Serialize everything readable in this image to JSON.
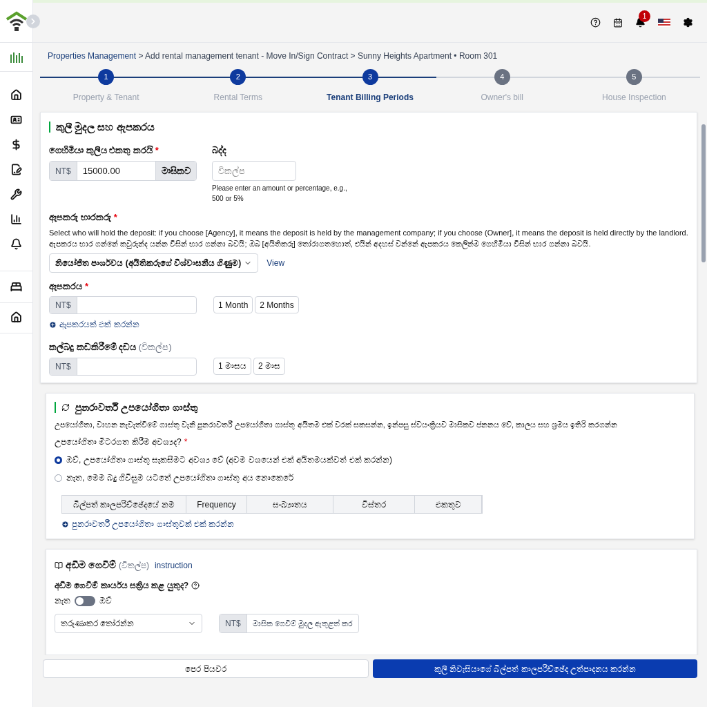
{
  "topbar": {
    "notification_count": "1"
  },
  "breadcrumb": {
    "link": "Properties Management",
    "path": " > Add rental management tenant - Move In/Sign Contract > Sunny Heights Apartment • Room 301"
  },
  "steps": [
    {
      "number": "1",
      "label": "Property & Tenant",
      "reached": true,
      "current": false
    },
    {
      "number": "2",
      "label": "Rental Terms",
      "reached": true,
      "current": false
    },
    {
      "number": "3",
      "label": "Tenant Billing Periods",
      "reached": true,
      "current": true
    },
    {
      "number": "4",
      "label": "Owner's bill",
      "reached": false,
      "current": false
    },
    {
      "number": "5",
      "label": "House Inspection",
      "reached": false,
      "current": false
    }
  ],
  "rent_section": {
    "title": "කුලී මුදල සහ ඇපකරය",
    "rent": {
      "label": "ගෙහිමියා කුලිය එකතු කරයි",
      "required_mark": "*",
      "prefix": "NT$",
      "value": "15000.00",
      "suffix": "මාසිකව"
    },
    "tax": {
      "label": "බද්ද",
      "placeholder": "විකල්ප",
      "help": "Please enter an amount or percentage, e.g., 500 or 5%"
    },
    "holder": {
      "label": "ඇපකරු භාරකරු",
      "required_mark": "*",
      "help_en": "Select who will hold the deposit: if you choose [Agency], it means the deposit is held by the management company;  if you choose (Owner], it means the deposit is held directly by the landlord.",
      "help_si": "ඇපකරය භාර ගන්නේ කවුරුන්ද යන්න විසින් භාර ගන්නා බවයි; ඔබ [අයිතිකරු] තෝරාගතහොත්, එයින් අදහස් වන්නේ ඇපකරය කෙලින්ම ගෙහිමියා විසින් භාර ගන්නා බවයි.",
      "value": "නියෝජිත පාර්ශවය (අයිතිකරුගේ විශ්වාසනීය ගිණුම)",
      "link": "View"
    },
    "deposit": {
      "label": "ඇපකරය",
      "required_mark": "*",
      "prefix": "NT$",
      "quick": [
        "1 Month",
        "2 Months"
      ],
      "add": "ඇපකරයක් එක් කරන්න"
    },
    "penalty": {
      "label": "කල්බදු කඩකිරීමේ දඩය",
      "optional": "(විකල්ප)",
      "prefix": "NT$",
      "quick": [
        "1 මාසය",
        "2 මාස"
      ]
    }
  },
  "utility_section": {
    "title": "පුනරාවර්තී උපයෝගිතා ගාස්තු",
    "description": "උපයෝගිතා, වාහන නැවැත්වීමේ ගාස්තු වැනි පුනරාවර්තී උපයෝගිතා ගාස්තු අයිතම එක් වරක් සකසන්න, ඉන්පසු ස්වයංක්‍රියව මාසිකව ජනනය වේ, කාලය සහ ශ්‍රමය ඉතිරි කරගන්න",
    "question": "උපයෝගිතා මීටරගත කිරීම අවශ්‍යද?",
    "required_mark": "*",
    "options": [
      {
        "label": "ඔව්, උපයෝගිතා ගාස්තු සැකසීමට අවශ්‍ය වේ (අවම වශයෙන් එක් අයිතමයක්වත් එක් කරන්න)",
        "selected": true
      },
      {
        "label": "නැත, මෙම බදු ගිවිසුම යටතේ උපයෝගිතා ගාස්තු අය නොකෙරේ",
        "selected": false
      }
    ],
    "table": {
      "columns": [
        "බිල්පත් කාලපරිච්ඡේදයේ නම",
        "Frequency",
        "සංඛ්‍යාතය",
        "විස්තර",
        "එකතුව"
      ]
    },
    "add": "පුනරාවර්තී උපයෝගිතා ගාස්තුවක් එක් කරන්න"
  },
  "installment_section": {
    "title": "අඩිම ගෙවීම්",
    "optional": "(විකල්ප)",
    "link": "instruction",
    "question": "අඩිම ගෙවීම් කාර්යය සක්‍රිය කළ යුතුද?",
    "off_label": "නැත",
    "on_label": "ඔව්",
    "on": false,
    "select": "තරුණාකර තෝරන්න",
    "prefix": "NT$",
    "placeholder": "මාසික ගෙවීම් මුදල ඇතුළත් කර"
  },
  "footer": {
    "back": "පෙර පියවර",
    "next": "කුලී නිවැසියාගේ බිල්පත් කාලපරිච්ඡේද උත්පාදනය කරන්න"
  }
}
